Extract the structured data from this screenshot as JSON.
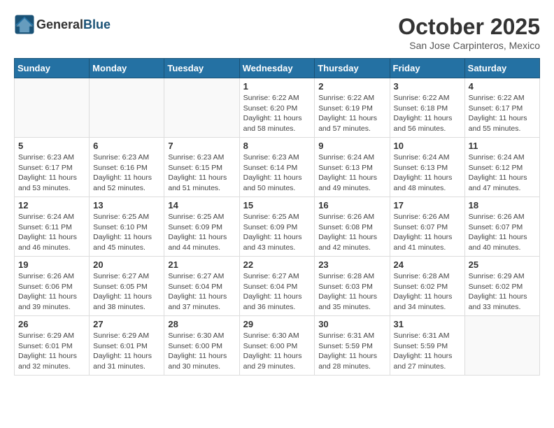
{
  "header": {
    "logo_general": "General",
    "logo_blue": "Blue",
    "month_title": "October 2025",
    "location": "San Jose Carpinteros, Mexico"
  },
  "weekdays": [
    "Sunday",
    "Monday",
    "Tuesday",
    "Wednesday",
    "Thursday",
    "Friday",
    "Saturday"
  ],
  "weeks": [
    [
      {
        "day": "",
        "info": ""
      },
      {
        "day": "",
        "info": ""
      },
      {
        "day": "",
        "info": ""
      },
      {
        "day": "1",
        "info": "Sunrise: 6:22 AM\nSunset: 6:20 PM\nDaylight: 11 hours\nand 58 minutes."
      },
      {
        "day": "2",
        "info": "Sunrise: 6:22 AM\nSunset: 6:19 PM\nDaylight: 11 hours\nand 57 minutes."
      },
      {
        "day": "3",
        "info": "Sunrise: 6:22 AM\nSunset: 6:18 PM\nDaylight: 11 hours\nand 56 minutes."
      },
      {
        "day": "4",
        "info": "Sunrise: 6:22 AM\nSunset: 6:17 PM\nDaylight: 11 hours\nand 55 minutes."
      }
    ],
    [
      {
        "day": "5",
        "info": "Sunrise: 6:23 AM\nSunset: 6:17 PM\nDaylight: 11 hours\nand 53 minutes."
      },
      {
        "day": "6",
        "info": "Sunrise: 6:23 AM\nSunset: 6:16 PM\nDaylight: 11 hours\nand 52 minutes."
      },
      {
        "day": "7",
        "info": "Sunrise: 6:23 AM\nSunset: 6:15 PM\nDaylight: 11 hours\nand 51 minutes."
      },
      {
        "day": "8",
        "info": "Sunrise: 6:23 AM\nSunset: 6:14 PM\nDaylight: 11 hours\nand 50 minutes."
      },
      {
        "day": "9",
        "info": "Sunrise: 6:24 AM\nSunset: 6:13 PM\nDaylight: 11 hours\nand 49 minutes."
      },
      {
        "day": "10",
        "info": "Sunrise: 6:24 AM\nSunset: 6:13 PM\nDaylight: 11 hours\nand 48 minutes."
      },
      {
        "day": "11",
        "info": "Sunrise: 6:24 AM\nSunset: 6:12 PM\nDaylight: 11 hours\nand 47 minutes."
      }
    ],
    [
      {
        "day": "12",
        "info": "Sunrise: 6:24 AM\nSunset: 6:11 PM\nDaylight: 11 hours\nand 46 minutes."
      },
      {
        "day": "13",
        "info": "Sunrise: 6:25 AM\nSunset: 6:10 PM\nDaylight: 11 hours\nand 45 minutes."
      },
      {
        "day": "14",
        "info": "Sunrise: 6:25 AM\nSunset: 6:09 PM\nDaylight: 11 hours\nand 44 minutes."
      },
      {
        "day": "15",
        "info": "Sunrise: 6:25 AM\nSunset: 6:09 PM\nDaylight: 11 hours\nand 43 minutes."
      },
      {
        "day": "16",
        "info": "Sunrise: 6:26 AM\nSunset: 6:08 PM\nDaylight: 11 hours\nand 42 minutes."
      },
      {
        "day": "17",
        "info": "Sunrise: 6:26 AM\nSunset: 6:07 PM\nDaylight: 11 hours\nand 41 minutes."
      },
      {
        "day": "18",
        "info": "Sunrise: 6:26 AM\nSunset: 6:07 PM\nDaylight: 11 hours\nand 40 minutes."
      }
    ],
    [
      {
        "day": "19",
        "info": "Sunrise: 6:26 AM\nSunset: 6:06 PM\nDaylight: 11 hours\nand 39 minutes."
      },
      {
        "day": "20",
        "info": "Sunrise: 6:27 AM\nSunset: 6:05 PM\nDaylight: 11 hours\nand 38 minutes."
      },
      {
        "day": "21",
        "info": "Sunrise: 6:27 AM\nSunset: 6:04 PM\nDaylight: 11 hours\nand 37 minutes."
      },
      {
        "day": "22",
        "info": "Sunrise: 6:27 AM\nSunset: 6:04 PM\nDaylight: 11 hours\nand 36 minutes."
      },
      {
        "day": "23",
        "info": "Sunrise: 6:28 AM\nSunset: 6:03 PM\nDaylight: 11 hours\nand 35 minutes."
      },
      {
        "day": "24",
        "info": "Sunrise: 6:28 AM\nSunset: 6:02 PM\nDaylight: 11 hours\nand 34 minutes."
      },
      {
        "day": "25",
        "info": "Sunrise: 6:29 AM\nSunset: 6:02 PM\nDaylight: 11 hours\nand 33 minutes."
      }
    ],
    [
      {
        "day": "26",
        "info": "Sunrise: 6:29 AM\nSunset: 6:01 PM\nDaylight: 11 hours\nand 32 minutes."
      },
      {
        "day": "27",
        "info": "Sunrise: 6:29 AM\nSunset: 6:01 PM\nDaylight: 11 hours\nand 31 minutes."
      },
      {
        "day": "28",
        "info": "Sunrise: 6:30 AM\nSunset: 6:00 PM\nDaylight: 11 hours\nand 30 minutes."
      },
      {
        "day": "29",
        "info": "Sunrise: 6:30 AM\nSunset: 6:00 PM\nDaylight: 11 hours\nand 29 minutes."
      },
      {
        "day": "30",
        "info": "Sunrise: 6:31 AM\nSunset: 5:59 PM\nDaylight: 11 hours\nand 28 minutes."
      },
      {
        "day": "31",
        "info": "Sunrise: 6:31 AM\nSunset: 5:59 PM\nDaylight: 11 hours\nand 27 minutes."
      },
      {
        "day": "",
        "info": ""
      }
    ]
  ]
}
